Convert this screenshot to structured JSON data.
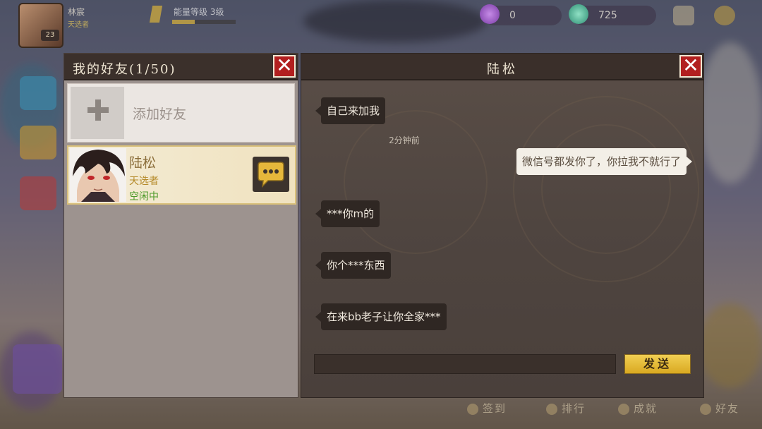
{
  "hud": {
    "player_name": "林宸",
    "player_sub": "天选者",
    "level": "23",
    "exp_label": "能量等级 3级",
    "exp_progress": 0.35,
    "currency": [
      {
        "icon": "purple-gem-icon",
        "value": "0"
      },
      {
        "icon": "green-crystal-icon",
        "value": "725"
      }
    ]
  },
  "friends": {
    "title": "我的好友(1/50)",
    "add_label": "添加好友",
    "list": [
      {
        "name": "陆松",
        "title": "天选者",
        "status": "空闲中"
      }
    ]
  },
  "chat": {
    "title": "陆松",
    "timestamp": "2分钟前",
    "messages": [
      {
        "side": "left",
        "text": "自己来加我"
      },
      {
        "side": "right",
        "text": "微信号都发你了，你拉我不就行了"
      },
      {
        "side": "left",
        "text": "***你m的"
      },
      {
        "side": "left",
        "text": "你个***东西"
      },
      {
        "side": "left",
        "text": "在来bb老子让你全家***"
      }
    ],
    "input_value": "",
    "send_label": "发送"
  },
  "bottom_nav": [
    {
      "label": "签到"
    },
    {
      "label": "排行"
    },
    {
      "label": "成就"
    },
    {
      "label": "好友"
    }
  ],
  "colors": {
    "close_red": "#b21f1f",
    "send_gold": "#e6bb34",
    "status_green": "#4d9a2a",
    "title_gold": "#b58a29"
  }
}
